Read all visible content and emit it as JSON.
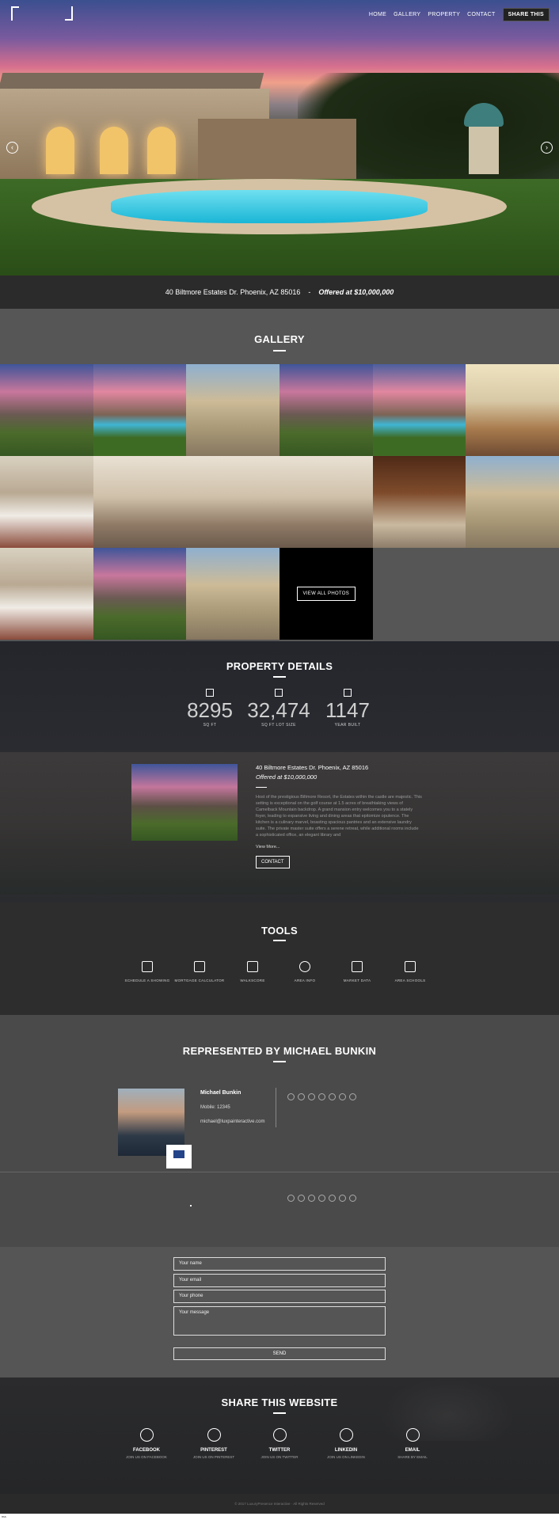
{
  "nav": {
    "items": [
      "HOME",
      "GALLERY",
      "PROPERTY",
      "CONTACT"
    ],
    "share_label": "SHARE THIS"
  },
  "hero": {
    "address": "40 Biltmore Estates Dr. Phoenix, AZ 85016",
    "separator": "-",
    "offer": "Offered at $10,000,000"
  },
  "gallery": {
    "title": "GALLERY",
    "view_all": "VIEW ALL PHOTOS"
  },
  "details": {
    "title": "PROPERTY DETAILS",
    "stats": [
      {
        "value": "8295",
        "label": "SQ FT"
      },
      {
        "value": "32,474",
        "label": "SQ FT LOT SIZE"
      },
      {
        "value": "1147",
        "label": "YEAR BUILT"
      }
    ],
    "address": "40 Biltmore Estates Dr. Phoenix, AZ 85016",
    "offer": "Offered at $10,000,000",
    "description": "Host of the prestigious Biltmore Resort, the Estates within the castle are majestic. This setting is exceptional on the golf course at 1.5 acres of breathtaking views of Camelback Mountain backdrop. A grand mansion entry welcomes you to a stately foyer, leading to expansive living and dining areas that epitomize opulence. The kitchen is a culinary marvel, boasting spacious pantries and an extensive laundry suite. The private master suite offers a serene retreat, while additional rooms include a sophisticated office, an elegant library and",
    "view_more": "View More...",
    "contact": "CONTACT"
  },
  "tools": {
    "title": "TOOLS",
    "items": [
      {
        "label": "SCHEDULE A SHOWING",
        "icon": "calendar-icon"
      },
      {
        "label": "MORTGAGE CALCULATOR",
        "icon": "calculator-icon"
      },
      {
        "label": "WALKSCORE",
        "icon": "document-icon"
      },
      {
        "label": "AREA INFO",
        "icon": "lifebuoy-icon"
      },
      {
        "label": "MARKET DATA",
        "icon": "bar-chart-icon"
      },
      {
        "label": "AREA SCHOOLS",
        "icon": "graduation-cap-icon"
      }
    ]
  },
  "agent": {
    "title": "REPRESENTED BY MICHAEL BUNKIN",
    "name": "Michael Bunkin",
    "mobile": "Mobile: 12345",
    "email": "michael@luxpainteractive.com"
  },
  "form": {
    "name_placeholder": "Your name",
    "email_placeholder": "Your email",
    "phone_placeholder": "Your phone",
    "message_placeholder": "Your message",
    "send": "SEND"
  },
  "share": {
    "title": "SHARE THIS WEBSITE",
    "items": [
      {
        "name": "FACEBOOK",
        "desc": "JOIN US ON FACEBOOK",
        "icon": "facebook-icon"
      },
      {
        "name": "PINTEREST",
        "desc": "JOIN US ON PINTEREST",
        "icon": "pinterest-icon"
      },
      {
        "name": "TWITTER",
        "desc": "JOIN US ON TWITTER",
        "icon": "twitter-icon"
      },
      {
        "name": "LINKEDIN",
        "desc": "JOIN US ON LINKEDIN",
        "icon": "linkedin-icon"
      },
      {
        "name": "EMAIL",
        "desc": "SHARE BY EMAIL",
        "icon": "email-icon"
      }
    ]
  },
  "footer": "© 2017 LuxuryPresence Interactive · All Rights Reserved",
  "corner_label": "ma"
}
